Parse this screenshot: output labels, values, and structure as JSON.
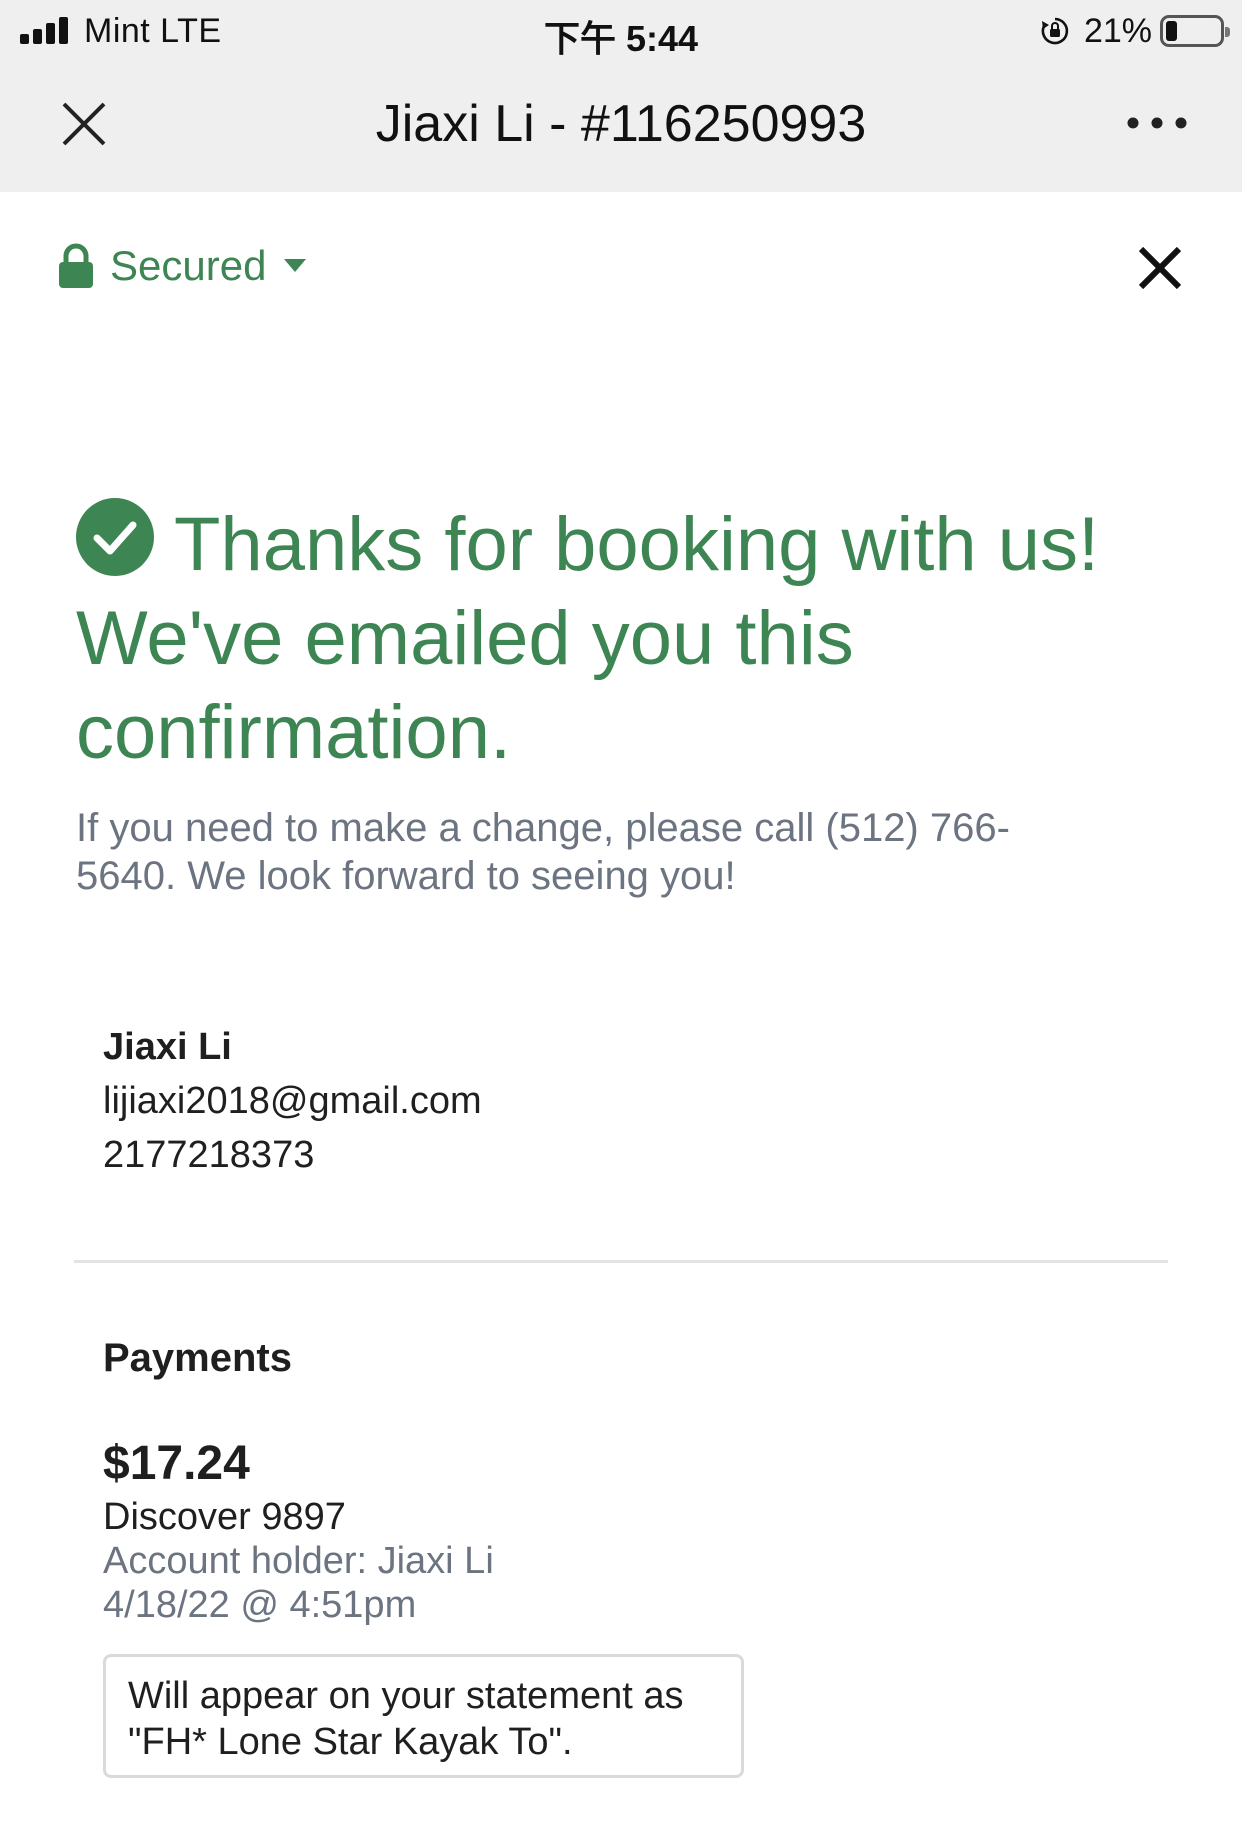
{
  "status_bar": {
    "carrier": "Mint   LTE",
    "time": "下午 5:44",
    "battery_percent": "21%",
    "battery_level": 0.21
  },
  "app_bar": {
    "title": "Jiaxi Li - #116250993",
    "close_icon": "close-icon",
    "more_icon": "more-horizontal-icon"
  },
  "security": {
    "label": "Secured",
    "icon": "lock-icon",
    "color": "#3d8553"
  },
  "confirmation": {
    "heading": "Thanks for booking with us! We've emailed you this confirmation.",
    "message": "If you need to make a change, please call (512) 766-5640. We look forward to seeing you!",
    "accent_color": "#3d8553"
  },
  "contact": {
    "name": "Jiaxi Li",
    "email": "lijiaxi2018@gmail.com",
    "phone": "2177218373"
  },
  "payments": {
    "title": "Payments",
    "amount": "$17.24",
    "card": "Discover 9897",
    "account_holder": "Account holder: Jiaxi Li",
    "date": "4/18/22 @ 4:51pm",
    "statement_note": "Will appear on your statement as \"FH* Lone Star Kayak To\"."
  }
}
